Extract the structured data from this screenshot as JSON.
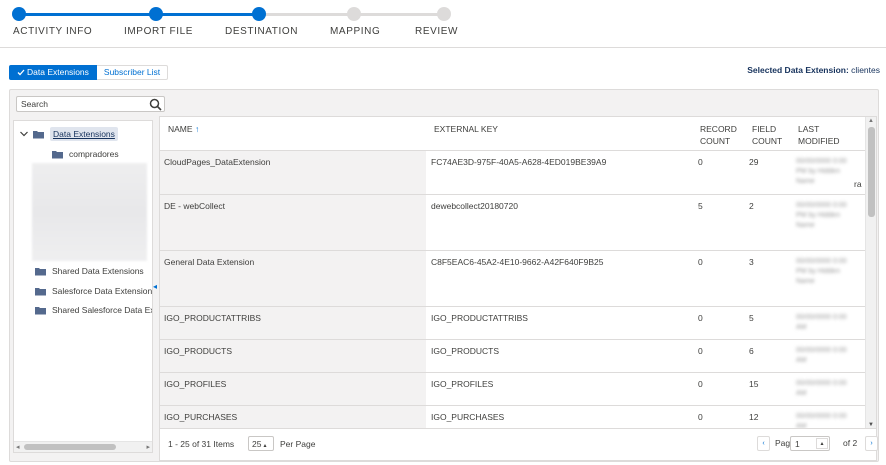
{
  "stepper": {
    "steps": [
      {
        "label": "ACTIVITY INFO",
        "status": "done"
      },
      {
        "label": "IMPORT FILE",
        "status": "done"
      },
      {
        "label": "DESTINATION",
        "status": "current"
      },
      {
        "label": "MAPPING",
        "status": "todo"
      },
      {
        "label": "REVIEW",
        "status": "todo"
      }
    ],
    "colors": {
      "done": "#0070d2",
      "todo": "#dddbda"
    }
  },
  "toggle": {
    "data_extensions_label": "Data Extensions",
    "subscriber_list_label": "Subscriber List",
    "check_icon": "check-icon"
  },
  "selected_extension": {
    "label": "Selected Data Extension:",
    "value": "clientes"
  },
  "search": {
    "placeholder": "Search",
    "icon": "search-icon"
  },
  "tree": {
    "root": {
      "label": "Data Extensions",
      "icon": "folder-open-icon"
    },
    "child": {
      "label": "compradores",
      "icon": "folder-icon"
    },
    "shared": {
      "label": "Shared Data Extensions"
    },
    "salesforce": {
      "label": "Salesforce Data Extensions"
    },
    "shared_salesforce": {
      "label": "Shared Salesforce Data Extensions"
    }
  },
  "grid": {
    "columns": {
      "name": "NAME",
      "sort_arrow": "↑",
      "external_key": "EXTERNAL KEY",
      "record_count_1": "RECORD",
      "record_count_2": "COUNT",
      "field_count_1": "FIELD",
      "field_count_2": "COUNT",
      "last_modified_1": "LAST",
      "last_modified_2": "MODIFIED"
    },
    "rows": [
      {
        "name": "CloudPages_DataExtension",
        "key": "FC74AE3D-975F-40A5-A628-4ED019BE39A9",
        "records": "0",
        "fields": "29",
        "modified": "00/00/0000 0:00 PM by Hidden Name",
        "modified_tail": "ra"
      },
      {
        "name": "DE - webCollect",
        "key": "dewebcollect20180720",
        "records": "5",
        "fields": "2",
        "modified": "00/00/0000 0:00 PM by Hidden Name"
      },
      {
        "name": "General Data Extension",
        "key": "C8F5EAC6-45A2-4E10-9662-A42F640F9B25",
        "records": "0",
        "fields": "3",
        "modified": "00/00/0000 0:00 PM by Hidden Name"
      },
      {
        "name": "IGO_PRODUCTATTRIBS",
        "key": "IGO_PRODUCTATTRIBS",
        "records": "0",
        "fields": "5",
        "modified": "00/00/0000 0:00 AM"
      },
      {
        "name": "IGO_PRODUCTS",
        "key": "IGO_PRODUCTS",
        "records": "0",
        "fields": "6",
        "modified": "00/00/0000 0:00 AM"
      },
      {
        "name": "IGO_PROFILES",
        "key": "IGO_PROFILES",
        "records": "0",
        "fields": "15",
        "modified": "00/00/0000 0:00 AM"
      },
      {
        "name": "IGO_PURCHASES",
        "key": "IGO_PURCHASES",
        "records": "0",
        "fields": "12",
        "modified": "00/00/0000 0:00 AM"
      }
    ]
  },
  "footer": {
    "items_text": "1 - 25 of 31 Items",
    "per_page_value": "25",
    "per_page_arrow": "▴",
    "per_page_label": "Per Page",
    "prev_icon": "‹",
    "page_label": "Page",
    "page_value": "1",
    "page_spin": "▴",
    "of_label": "of 2",
    "next_icon": "›"
  }
}
